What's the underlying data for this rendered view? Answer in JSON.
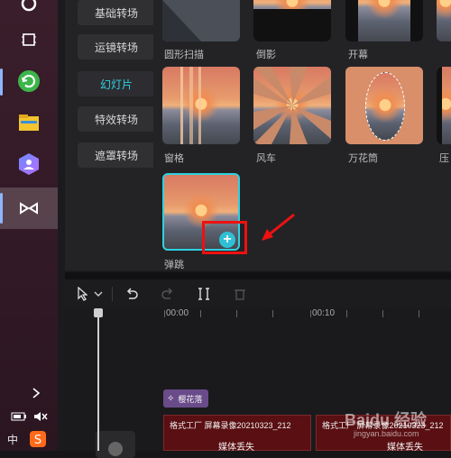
{
  "taskbar": {
    "ime": "中",
    "icons": [
      "circle-icon",
      "film-strip-icon",
      "refresh-app-icon",
      "file-explorer-icon",
      "photos-icon",
      "capcut-icon"
    ]
  },
  "categories": [
    {
      "label": "基础转场",
      "active": false
    },
    {
      "label": "运镜转场",
      "active": false
    },
    {
      "label": "幻灯片",
      "active": true
    },
    {
      "label": "特效转场",
      "active": false
    },
    {
      "label": "遮罩转场",
      "active": false
    }
  ],
  "transitions": {
    "row1": [
      "圆形扫描",
      "倒影",
      "开幕"
    ],
    "row2": [
      "窗格",
      "风车",
      "万花筒",
      "压"
    ],
    "row3": [
      "弹跳"
    ]
  },
  "timeline": {
    "ruler": [
      "00:00",
      "00:10"
    ],
    "effect_label": "樱花落",
    "clip1_title": "格式工厂 屏幕录像20210323_212",
    "clip2_title": "格式工厂 屏幕录像20210323_212",
    "clip_status": "媒体丢失",
    "watermark": "Baidu 经验",
    "watermark_url": "jingyan.baidu.com"
  },
  "colors": {
    "accent": "#2fd1e0",
    "annotation": "#e11111",
    "clip": "#5a0f12",
    "effect": "#6a4b8a"
  }
}
